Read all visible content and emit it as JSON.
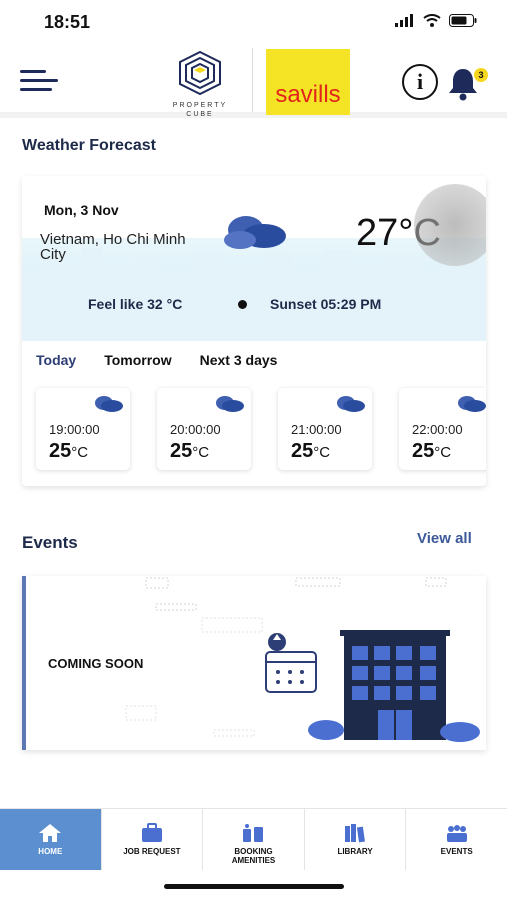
{
  "status": {
    "time": "18:51"
  },
  "header": {
    "brand_line1": "PROPERTY",
    "brand_line2": "CUBE",
    "partner": "savills",
    "info_glyph": "i",
    "notification_count": "3"
  },
  "weather": {
    "section_title": "Weather Forecast",
    "date": "Mon, 3 Nov",
    "location": "Vietnam, Ho Chi Minh City",
    "temperature": "27°C",
    "feels_like": "Feel like 32 °C",
    "sunset": "Sunset 05:29 PM",
    "tabs": [
      "Today",
      "Tomorrow",
      "Next 3 days"
    ],
    "hours": [
      {
        "time": "19:00:00",
        "temp": "25",
        "unit": "°C",
        "icon": "cloud-icon"
      },
      {
        "time": "20:00:00",
        "temp": "25",
        "unit": "°C",
        "icon": "cloud-icon"
      },
      {
        "time": "21:00:00",
        "temp": "25",
        "unit": "°C",
        "icon": "cloud-icon"
      },
      {
        "time": "22:00:00",
        "temp": "25",
        "unit": "°C",
        "icon": "cloud-icon"
      }
    ]
  },
  "events": {
    "section_title": "Events",
    "view_all": "View all",
    "card_text": "COMING SOON"
  },
  "nav": [
    {
      "label": "HOME",
      "icon": "home-icon"
    },
    {
      "label": "JOB REQUEST",
      "icon": "briefcase-icon"
    },
    {
      "label": "BOOKING AMENITIES",
      "icon": "booking-icon"
    },
    {
      "label": "LIBRARY",
      "icon": "library-icon"
    },
    {
      "label": "EVENTS",
      "icon": "events-icon"
    }
  ],
  "colors": {
    "accent": "#5b8fcf",
    "brand_navy": "#1e2a4a",
    "savills_yellow": "#f5e326",
    "savills_red": "#e1251b",
    "badge": "#f5d81e"
  }
}
